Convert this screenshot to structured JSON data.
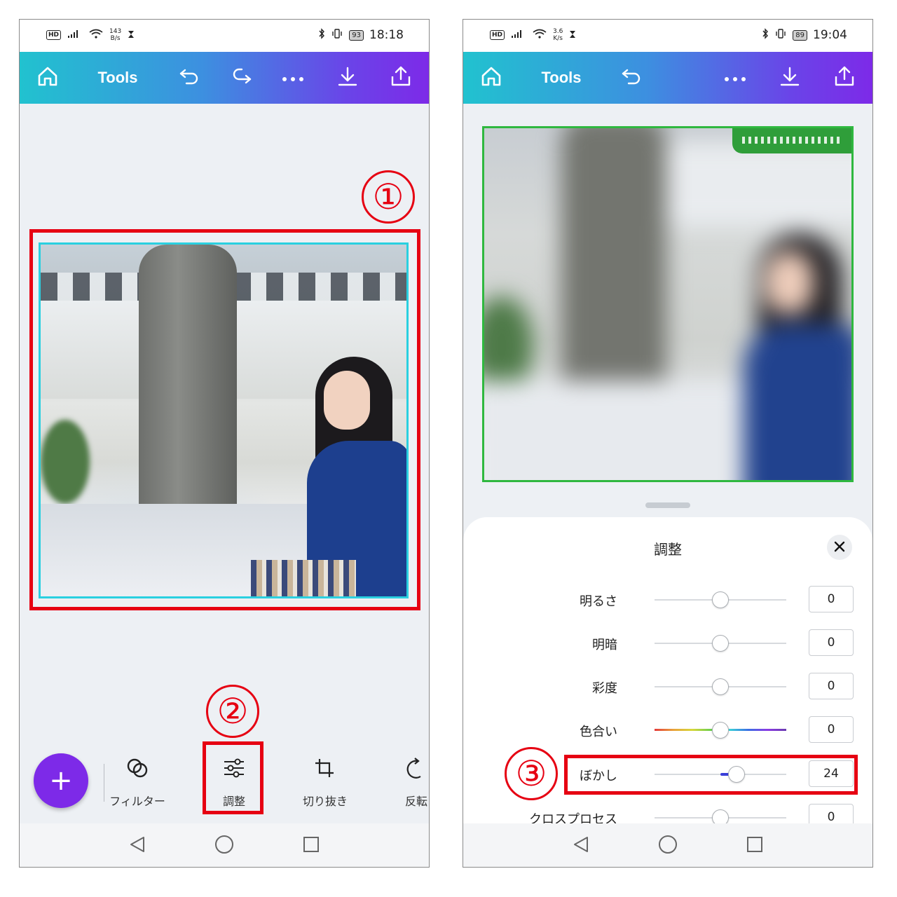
{
  "left_screen": {
    "status": {
      "hd": "HD",
      "speed_value": "143",
      "speed_unit": "B/s",
      "battery": "93",
      "time": "18:18"
    },
    "toolbar": {
      "home_icon": "home-icon",
      "title": "Tools",
      "undo_icon": "undo-icon",
      "redo_icon": "redo-icon",
      "more_icon": "more-icon",
      "download_icon": "download-icon",
      "share_icon": "share-icon"
    },
    "bottom_tools": {
      "add_icon": "plus-icon",
      "filter": {
        "label": "フィルター",
        "icon": "filter-icon"
      },
      "adjust": {
        "label": "調整",
        "icon": "sliders-icon"
      },
      "crop": {
        "label": "切り抜き",
        "icon": "crop-icon"
      },
      "flip": {
        "label": "反転",
        "icon": "flip-icon"
      }
    },
    "annotations": {
      "photo_marker": "①",
      "adjust_marker": "②"
    }
  },
  "right_screen": {
    "status": {
      "hd": "HD",
      "speed_value": "3.6",
      "speed_unit": "K/s",
      "battery": "89",
      "time": "19:04"
    },
    "toolbar": {
      "title": "Tools"
    },
    "panel": {
      "title": "調整",
      "close_icon": "close-icon",
      "sliders": [
        {
          "label": "明るさ",
          "value": "0",
          "level": 0.5
        },
        {
          "label": "明暗",
          "value": "0",
          "level": 0.5
        },
        {
          "label": "彩度",
          "value": "0",
          "level": 0.5
        },
        {
          "label": "色合い",
          "value": "0",
          "level": 0.5
        },
        {
          "label": "ぼかし",
          "value": "24",
          "level": 0.62
        },
        {
          "label": "クロスプロセス",
          "value": "0",
          "level": 0.5
        }
      ]
    },
    "annotations": {
      "blur_marker": "③"
    }
  },
  "colors": {
    "annotation_red": "#e60012",
    "brand_purple": "#7d2ae8",
    "gradient_start": "#21c2cf",
    "gradient_end": "#7d2ae8",
    "selection_cyan": "#2ad0e0",
    "selection_green": "#2fb83f"
  }
}
